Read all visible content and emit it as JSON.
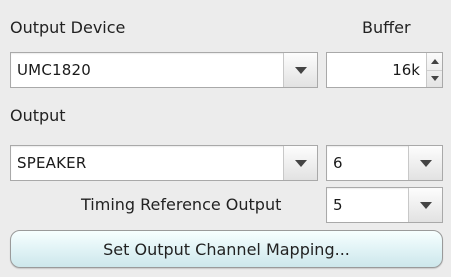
{
  "output_device": {
    "label": "Output Device",
    "value": "UMC1820",
    "arrow_icon": "chevron-down-icon"
  },
  "buffer": {
    "label": "Buffer",
    "value": "16k"
  },
  "output": {
    "label": "Output",
    "value": "SPEAKER",
    "channel_value": "6"
  },
  "timing": {
    "label": "Timing Reference Output",
    "value": "5"
  },
  "mapping_button": {
    "label": "Set Output Channel Mapping..."
  },
  "colors": {
    "background": "#ececec",
    "button_accent": "#dff2f5"
  }
}
